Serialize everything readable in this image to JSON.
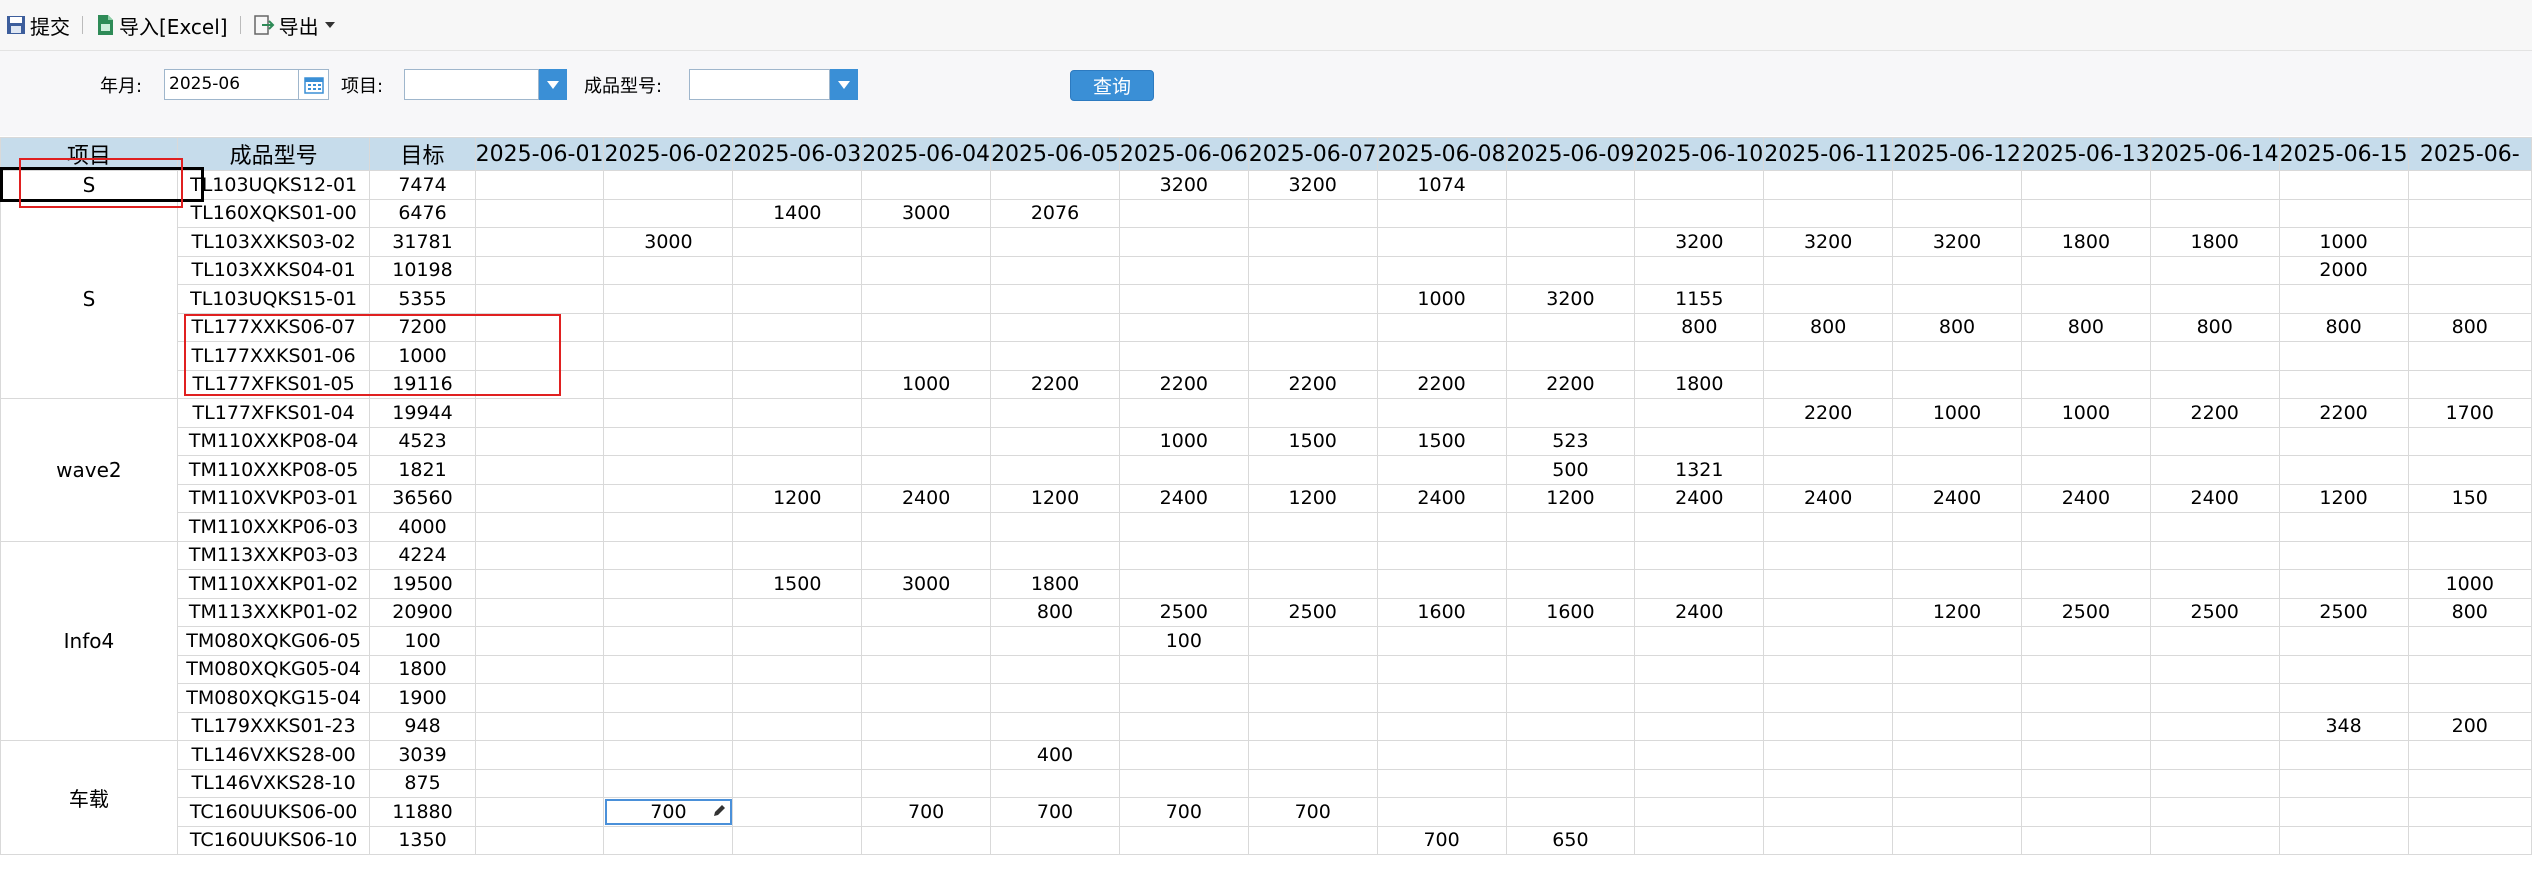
{
  "toolbar": {
    "submit": "提交",
    "import": "导入[Excel]",
    "export": "导出"
  },
  "filter": {
    "year_month_label": "年月:",
    "year_month_value": "2025-06",
    "project_label": "项目:",
    "project_value": "",
    "model_label": "成品型号:",
    "model_value": "",
    "query_label": "查询"
  },
  "grid": {
    "headers": {
      "project": "项目",
      "model": "成品型号",
      "target": "目标"
    },
    "dates": [
      "2025-06-01",
      "2025-06-02",
      "2025-06-03",
      "2025-06-04",
      "2025-06-05",
      "2025-06-06",
      "2025-06-07",
      "2025-06-08",
      "2025-06-09",
      "2025-06-10",
      "2025-06-11",
      "2025-06-12",
      "2025-06-13",
      "2025-06-14",
      "2025-06-15",
      "2025-06-"
    ],
    "groups": [
      {
        "project": "S",
        "rows": [
          {
            "model": "TL103UQKS12-01",
            "target": "7474",
            "values": [
              "",
              "",
              "",
              "",
              "",
              "3200",
              "3200",
              "1074",
              "",
              "",
              "",
              "",
              "",
              "",
              "",
              ""
            ]
          }
        ]
      },
      {
        "project": "S",
        "rows": [
          {
            "model": "TL160XQKS01-00",
            "target": "6476",
            "values": [
              "",
              "",
              "1400",
              "3000",
              "2076",
              "",
              "",
              "",
              "",
              "",
              "",
              "",
              "",
              "",
              "",
              ""
            ]
          },
          {
            "model": "TL103XXKS03-02",
            "target": "31781",
            "values": [
              "",
              "3000",
              "",
              "",
              "",
              "",
              "",
              "",
              "",
              "3200",
              "3200",
              "3200",
              "1800",
              "1800",
              "1000",
              ""
            ]
          },
          {
            "model": "TL103XXKS04-01",
            "target": "10198",
            "values": [
              "",
              "",
              "",
              "",
              "",
              "",
              "",
              "",
              "",
              "",
              "",
              "",
              "",
              "",
              "2000",
              ""
            ]
          },
          {
            "model": "TL103UQKS15-01",
            "target": "5355",
            "values": [
              "",
              "",
              "",
              "",
              "",
              "",
              "",
              "1000",
              "3200",
              "1155",
              "",
              "",
              "",
              "",
              "",
              ""
            ]
          },
          {
            "model": "TL177XXKS06-07",
            "target": "7200",
            "values": [
              "",
              "",
              "",
              "",
              "",
              "",
              "",
              "",
              "",
              "800",
              "800",
              "800",
              "800",
              "800",
              "800",
              "800"
            ]
          },
          {
            "model": "TL177XXKS01-06",
            "target": "1000",
            "values": [
              "",
              "",
              "",
              "",
              "",
              "",
              "",
              "",
              "",
              "",
              "",
              "",
              "",
              "",
              "",
              ""
            ]
          },
          {
            "model": "TL177XFKS01-05",
            "target": "19116",
            "values": [
              "",
              "",
              "",
              "1000",
              "2200",
              "2200",
              "2200",
              "2200",
              "2200",
              "1800",
              "",
              "",
              "",
              "",
              "",
              ""
            ]
          }
        ]
      },
      {
        "project": "wave2",
        "rows": [
          {
            "model": "TL177XFKS01-04",
            "target": "19944",
            "values": [
              "",
              "",
              "",
              "",
              "",
              "",
              "",
              "",
              "",
              "",
              "2200",
              "1000",
              "1000",
              "2200",
              "2200",
              "1700"
            ]
          },
          {
            "model": "TM110XXKP08-04",
            "target": "4523",
            "values": [
              "",
              "",
              "",
              "",
              "",
              "1000",
              "1500",
              "1500",
              "523",
              "",
              "",
              "",
              "",
              "",
              "",
              ""
            ]
          },
          {
            "model": "TM110XXKP08-05",
            "target": "1821",
            "values": [
              "",
              "",
              "",
              "",
              "",
              "",
              "",
              "",
              "500",
              "1321",
              "",
              "",
              "",
              "",
              "",
              ""
            ]
          },
          {
            "model": "TM110XVKP03-01",
            "target": "36560",
            "values": [
              "",
              "",
              "1200",
              "2400",
              "1200",
              "2400",
              "1200",
              "2400",
              "1200",
              "2400",
              "2400",
              "2400",
              "2400",
              "2400",
              "1200",
              "150"
            ]
          },
          {
            "model": "TM110XXKP06-03",
            "target": "4000",
            "values": [
              "",
              "",
              "",
              "",
              "",
              "",
              "",
              "",
              "",
              "",
              "",
              "",
              "",
              "",
              "",
              ""
            ]
          }
        ]
      },
      {
        "project": "Info4",
        "rows": [
          {
            "model": "TM113XXKP03-03",
            "target": "4224",
            "values": [
              "",
              "",
              "",
              "",
              "",
              "",
              "",
              "",
              "",
              "",
              "",
              "",
              "",
              "",
              "",
              ""
            ]
          },
          {
            "model": "TM110XXKP01-02",
            "target": "19500",
            "values": [
              "",
              "",
              "1500",
              "3000",
              "1800",
              "",
              "",
              "",
              "",
              "",
              "",
              "",
              "",
              "",
              "",
              "1000"
            ]
          },
          {
            "model": "TM113XXKP01-02",
            "target": "20900",
            "values": [
              "",
              "",
              "",
              "",
              "800",
              "2500",
              "2500",
              "1600",
              "1600",
              "2400",
              "",
              "1200",
              "2500",
              "2500",
              "2500",
              "800"
            ]
          },
          {
            "model": "TM080XQKG06-05",
            "target": "100",
            "values": [
              "",
              "",
              "",
              "",
              "",
              "100",
              "",
              "",
              "",
              "",
              "",
              "",
              "",
              "",
              "",
              ""
            ]
          },
          {
            "model": "TM080XQKG05-04",
            "target": "1800",
            "values": [
              "",
              "",
              "",
              "",
              "",
              "",
              "",
              "",
              "",
              "",
              "",
              "",
              "",
              "",
              "",
              ""
            ]
          },
          {
            "model": "TM080XQKG15-04",
            "target": "1900",
            "values": [
              "",
              "",
              "",
              "",
              "",
              "",
              "",
              "",
              "",
              "",
              "",
              "",
              "",
              "",
              "",
              ""
            ]
          },
          {
            "model": "TL179XXKS01-23",
            "target": "948",
            "values": [
              "",
              "",
              "",
              "",
              "",
              "",
              "",
              "",
              "",
              "",
              "",
              "",
              "",
              "",
              "348",
              "200"
            ]
          }
        ]
      },
      {
        "project": "车载",
        "rows": [
          {
            "model": "TL146VXKS28-00",
            "target": "3039",
            "values": [
              "",
              "",
              "",
              "",
              "400",
              "",
              "",
              "",
              "",
              "",
              "",
              "",
              "",
              "",
              "",
              ""
            ]
          },
          {
            "model": "TL146VXKS28-10",
            "target": "875",
            "values": [
              "",
              "",
              "",
              "",
              "",
              "",
              "",
              "",
              "",
              "",
              "",
              "",
              "",
              "",
              "",
              ""
            ]
          },
          {
            "model": "TC160UUKS06-00",
            "target": "11880",
            "values": [
              "",
              "700",
              "",
              "700",
              "700",
              "700",
              "700",
              "",
              "",
              "",
              "",
              "",
              "",
              "",
              "",
              ""
            ]
          },
          {
            "model": "TC160UUKS06-10",
            "target": "1350",
            "values": [
              "",
              "",
              "",
              "",
              "",
              "",
              "",
              "700",
              "650",
              "",
              "",
              "",
              "",
              "",
              "",
              ""
            ]
          }
        ]
      }
    ]
  },
  "colors": {
    "header_bg": "#c6dceb",
    "accent": "#3a8fd6",
    "highlight_box": "#e02020"
  }
}
